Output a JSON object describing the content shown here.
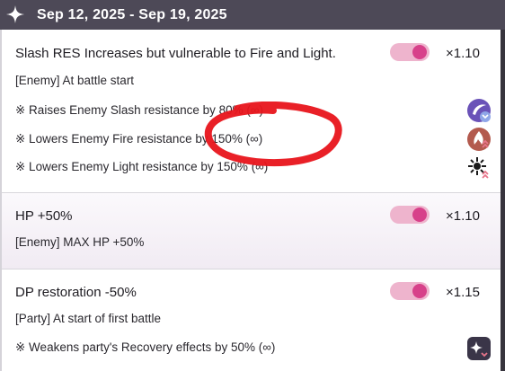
{
  "header": {
    "date_range": "Sep 12, 2025 - Sep 19, 2025"
  },
  "sections": [
    {
      "title": "Slash RES Increases but vulnerable to Fire and Light.",
      "multiplier": "×1.10",
      "subtitle": "[Enemy] At battle start",
      "toggle_on": true,
      "effects": [
        {
          "text": "※ Raises Enemy Slash resistance by 80% (∞)",
          "icon": "slash-resist-up-icon"
        },
        {
          "text": "※ Lowers Enemy Fire resistance by 150% (∞)",
          "icon": "fire-resist-down-icon"
        },
        {
          "text": "※ Lowers Enemy Light resistance by 150% (∞)",
          "icon": "light-resist-down-icon"
        }
      ]
    },
    {
      "title": "HP +50%",
      "multiplier": "×1.10",
      "subtitle": "[Enemy] MAX HP +50%",
      "toggle_on": true,
      "effects": []
    },
    {
      "title": "DP restoration -50%",
      "multiplier": "×1.15",
      "subtitle": "[Party] At start of first battle",
      "toggle_on": true,
      "effects": [
        {
          "text": "※ Weakens party's Recovery effects by 50% (∞)",
          "icon": "recovery-down-icon"
        }
      ]
    }
  ],
  "colors": {
    "header_bg": "#4d4957",
    "toggle_track": "#eeb4cd",
    "toggle_knob": "#d7418a",
    "annotation": "#e8141b"
  }
}
